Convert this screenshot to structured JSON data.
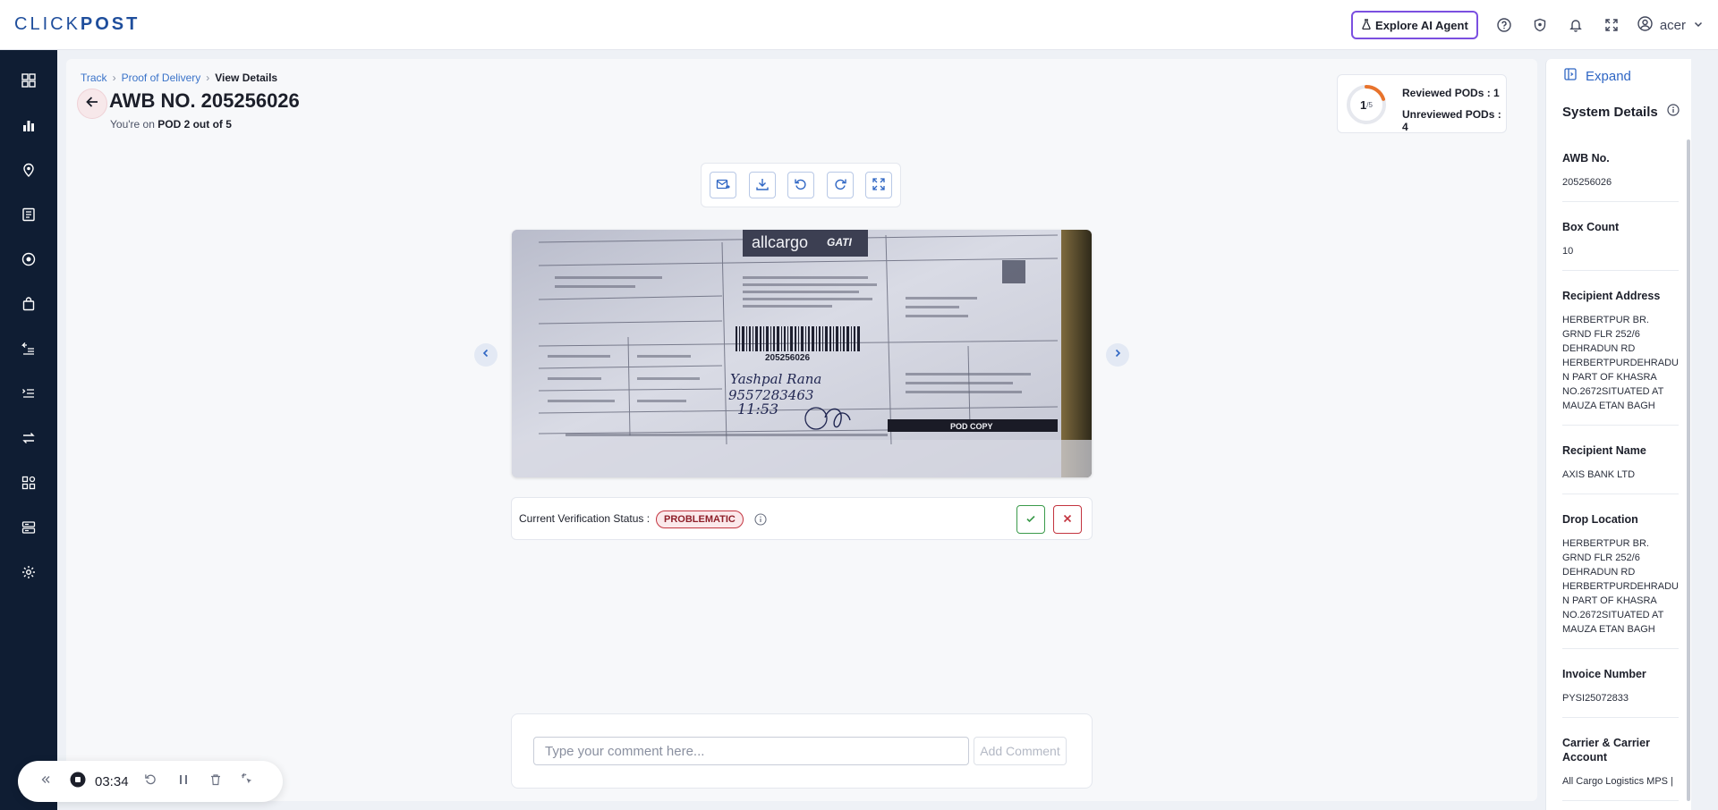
{
  "header": {
    "logo": "CLICKPOST",
    "ai_button_label": "Explore AI Agent",
    "user_name": "acer"
  },
  "sidebar": {
    "items": [
      "dashboard-icon",
      "analytics-icon",
      "location-pin-icon",
      "list-icon",
      "circle-target-icon",
      "bag-icon",
      "returns-icon",
      "orders-list-icon",
      "exchange-icon",
      "apps-icon",
      "server-icon",
      "gear-icon"
    ]
  },
  "breadcrumb": {
    "track": "Track",
    "pod": "Proof of Delivery",
    "current": "View Details"
  },
  "page": {
    "title": "AWB NO. 205256026",
    "sub_prefix": "You're on",
    "sub_value": "POD 2 out of 5"
  },
  "review": {
    "reviewed_count": "1",
    "total": "/5",
    "reviewed_label": "Reviewed PODs : 1",
    "unreviewed_label": "Unreviewed PODs : 4",
    "progress_fraction": 0.2
  },
  "toolbar": {
    "tools": [
      "email-forward-icon",
      "download-icon",
      "rotate-left-icon",
      "rotate-right-icon",
      "fullscreen-icon"
    ]
  },
  "pod_image": {
    "brand": "allcargo",
    "brand2": "GATI",
    "awb_text": "205256026",
    "handwriting_name": "Yashpal Rana",
    "handwriting_phone": "9557283463",
    "handwriting_time": "11:53",
    "stamp_label": "POD COPY"
  },
  "verification": {
    "label": "Current Verification Status :",
    "status": "PROBLEMATIC"
  },
  "comment": {
    "placeholder": "Type your comment here...",
    "button_label": "Add Comment"
  },
  "right_panel": {
    "expand_label": "Expand",
    "title": "System Details",
    "fields": [
      {
        "label": "AWB No.",
        "value": "205256026"
      },
      {
        "label": "Box Count",
        "value": "10"
      },
      {
        "label": "Recipient Address",
        "value": "HERBERTPUR BR. GRND FLR 252/6 DEHRADUN RD HERBERTPURDEHRADUN PART OF KHASRA NO.2672SITUATED AT MAUZA ETAN BAGH"
      },
      {
        "label": "Recipient Name",
        "value": "AXIS BANK LTD"
      },
      {
        "label": "Drop Location",
        "value": "HERBERTPUR BR. GRND FLR 252/6 DEHRADUN RD HERBERTPURDEHRADUN PART OF KHASRA NO.2672SITUATED AT MAUZA ETAN BAGH"
      },
      {
        "label": "Invoice Number",
        "value": "PYSI25072833"
      },
      {
        "label": "Carrier & Carrier Account",
        "value": "All Cargo Logistics MPS |"
      }
    ]
  },
  "recorder": {
    "time": "03:34"
  },
  "colors": {
    "sidebar_bg": "#0f1d33",
    "accent_blue": "#2f66c4",
    "ai_border": "#7b4fe0",
    "problem_red": "#c3343f",
    "approve_green": "#3a9a4a",
    "ring_orange": "#e8732c"
  }
}
